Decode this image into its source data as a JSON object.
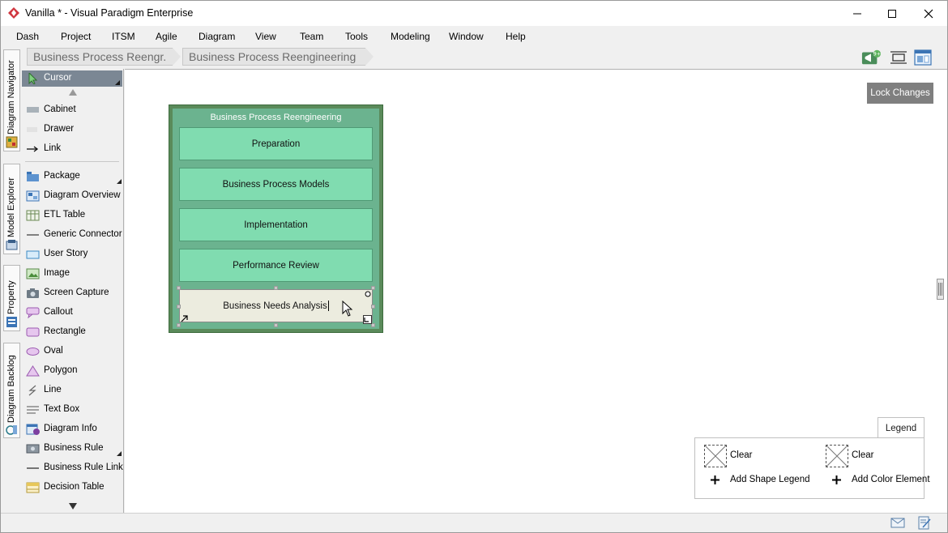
{
  "window": {
    "title": "Vanilla * - Visual Paradigm Enterprise",
    "minimize_icon": "minimize-icon",
    "maximize_icon": "maximize-icon",
    "close_icon": "close-icon"
  },
  "menu": [
    "Dash",
    "Project",
    "ITSM",
    "Agile",
    "Diagram",
    "View",
    "Team",
    "Tools",
    "Modeling",
    "Window",
    "Help"
  ],
  "breadcrumb": [
    "Business Process Reengr.",
    "Business Process Reengineering"
  ],
  "toolbar": {
    "notification_badge": "9+"
  },
  "side_tabs": [
    "Diagram Navigator",
    "Model Explorer",
    "Property",
    "Diagram Backlog"
  ],
  "palette": {
    "cursor": "Cursor",
    "group1": [
      "Cabinet",
      "Drawer",
      "Link"
    ],
    "group2": [
      "Package",
      "Diagram Overview",
      "ETL Table",
      "Generic Connector",
      "User Story",
      "Image",
      "Screen Capture",
      "Callout",
      "Rectangle",
      "Oval",
      "Polygon",
      "Line",
      "Text Box",
      "Diagram Info",
      "Business Rule",
      "Business Rule Link",
      "Decision Table"
    ]
  },
  "canvas": {
    "lock_button": "Lock Changes",
    "diagram_title": "Business Process Reengineering",
    "steps": [
      "Preparation",
      "Business Process Models",
      "Implementation",
      "Performance Review"
    ],
    "editing_step": "Business Needs Analysis"
  },
  "legend": {
    "tab": "Legend",
    "clear_left": "Clear",
    "clear_right": "Clear",
    "add_shape": "Add Shape Legend",
    "add_color": "Add Color Element"
  },
  "colors": {
    "container_green": "#5a8a5a",
    "step_green": "#80dcb0",
    "selected_cursor": "#7b8794",
    "accent_red": "#d0363f"
  }
}
